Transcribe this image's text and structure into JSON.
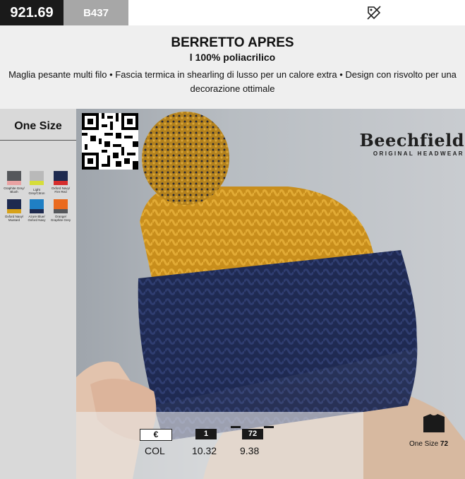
{
  "product": {
    "code": "921.69",
    "model": "B437",
    "title": "BERRETTO APRES",
    "material": "l 100% poliacrilico",
    "description": "Maglia pesante multi filo • Fascia termica in shearling di lusso per un calore extra • Design con risvolto per una decorazione ottimale"
  },
  "sizes": {
    "label": "One Size"
  },
  "colors": [
    {
      "name": "Graphite Grey/ Blush",
      "top": "#55575b",
      "bottom": "#e9a2a2"
    },
    {
      "name": "Light Grey/Citron",
      "top": "#b9b9b9",
      "bottom": "#d6dd3a"
    },
    {
      "name": "Oxford Navy/ Fire Red",
      "top": "#1e2a4f",
      "bottom": "#d62d2d"
    },
    {
      "name": "Oxford Navy/ Mustard",
      "top": "#1e2a4f",
      "bottom": "#d7a21a"
    },
    {
      "name": "Azure Blue/ Oxford Navy",
      "top": "#1f7fc4",
      "bottom": "#1e2a4f"
    },
    {
      "name": "Orange/ Graphite Grey",
      "top": "#ea6a1e",
      "bottom": "#55575b"
    }
  ],
  "brand": {
    "name": "Beechfield",
    "tagline": "ORIGINAL HEADWEAR"
  },
  "pricing": {
    "currency": "€",
    "col_label": "COL",
    "qty1": "1",
    "qty2": "72",
    "price1": "10.32",
    "price2": "9.38"
  },
  "packaging": {
    "size": "One Size",
    "qty": "72"
  },
  "icons": {
    "promo": "discount-tag-icon",
    "shirt": "tshirt-icon"
  }
}
